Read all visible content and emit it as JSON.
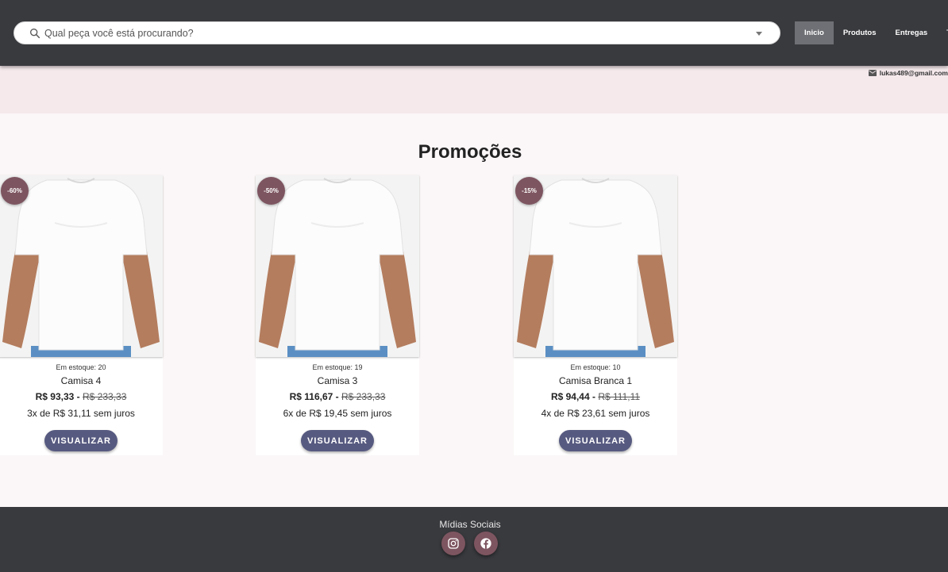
{
  "search": {
    "placeholder": "Qual peça você está procurando?"
  },
  "nav": {
    "tabs": [
      "Inicio",
      "Produtos",
      "Entregas",
      "Tr"
    ]
  },
  "contact": {
    "email": "lukas489@gmail.com"
  },
  "section_title": "Promoções",
  "buttons": {
    "view_label": "VISUALIZAR"
  },
  "products": [
    {
      "discount": "-60%",
      "stock": "Em estoque: 20",
      "name": "Camisa 4",
      "price": "R$ 93,33",
      "old_price": "R$ 233,33",
      "installments": "3x de R$ 31,11 sem juros"
    },
    {
      "discount": "-50%",
      "stock": "Em estoque: 19",
      "name": "Camisa 3",
      "price": "R$ 116,67",
      "old_price": "R$ 233,33",
      "installments": "6x de R$ 19,45 sem juros"
    },
    {
      "discount": "-15%",
      "stock": "Em estoque: 10",
      "name": "Camisa Branca 1",
      "price": "R$ 94,44",
      "old_price": "R$ 111,11",
      "installments": "4x de R$ 23,61 sem juros"
    }
  ],
  "footer": {
    "title": "Mídias Sociais",
    "icons": [
      "instagram-icon",
      "facebook-icon"
    ]
  },
  "colors": {
    "header_bg": "#393a3e",
    "badge": "#7d5560",
    "button": "#575a80",
    "band": "#f5e9ec"
  }
}
